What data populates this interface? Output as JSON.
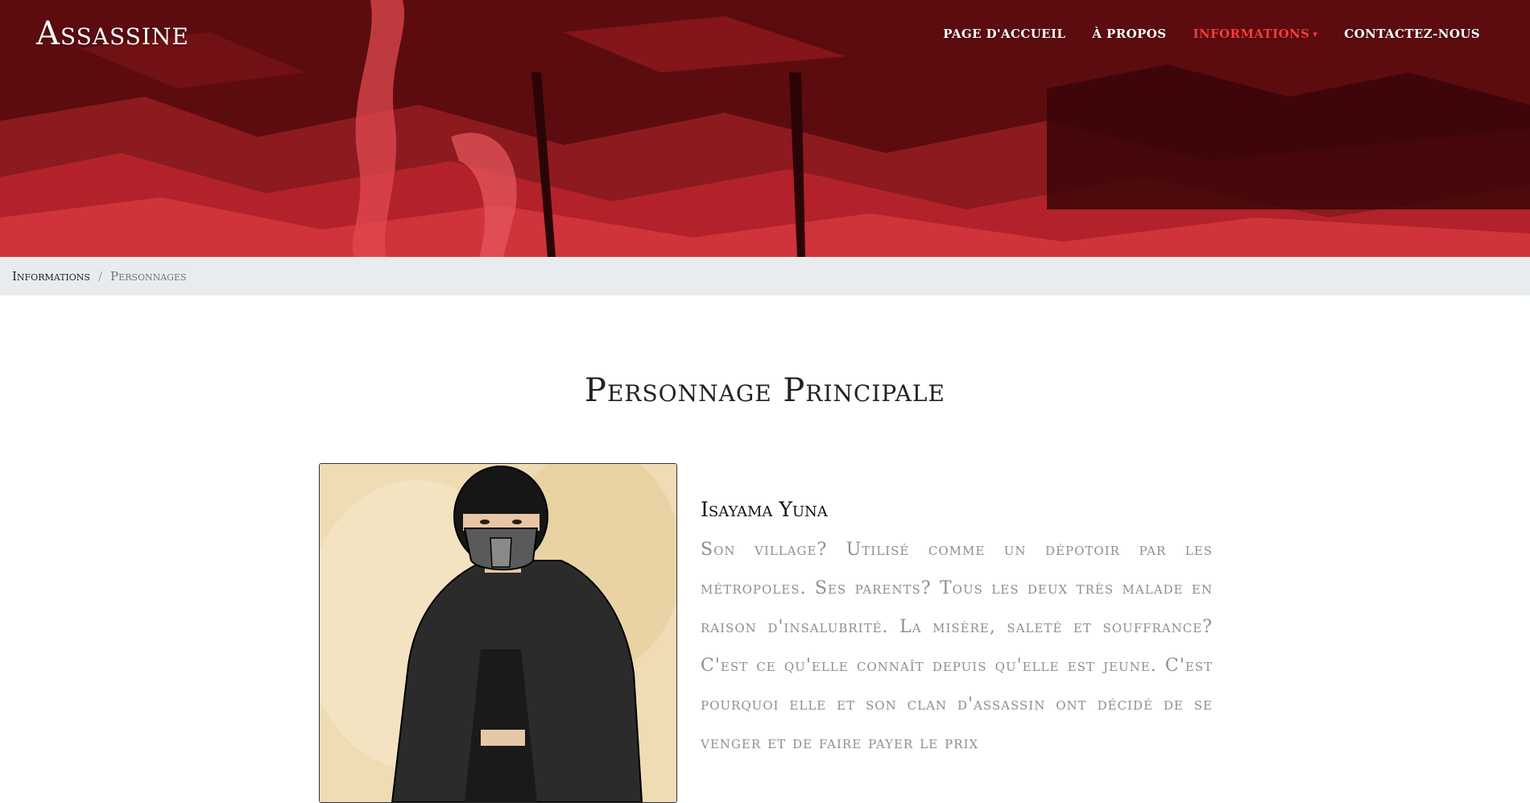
{
  "header": {
    "logo": "Assassine",
    "nav": [
      {
        "label": "Page d'accueil"
      },
      {
        "label": "À propos"
      },
      {
        "label": "Informations",
        "active": true
      },
      {
        "label": "Contactez-nous"
      }
    ]
  },
  "breadcrumb": {
    "parent": "Informations",
    "separator": "/",
    "current": "Personnages"
  },
  "main": {
    "title": "Personnage Principale",
    "character": {
      "name": "Isayama Yuna",
      "description": "Son village? Utilisé comme un dépotoir par les métropoles. Ses parents? Tous les deux très malade en raison d'insalubrité. La misère, saleté et souffrance? C'est ce qu'elle connaît depuis qu'elle est jeune. C'est pourquoi elle et son clan d'assassin ont décidé de se venger et de faire payer le prix"
    }
  },
  "colors": {
    "hero_dark": "#5c0c0f",
    "hero_red": "#c1272d",
    "nav_active": "#ff3b3b",
    "breadcrumb_bg": "#e9ecef",
    "card_bg": "#efdcb5"
  },
  "icons": {
    "nav_dropdown": "chevron-down-icon"
  }
}
